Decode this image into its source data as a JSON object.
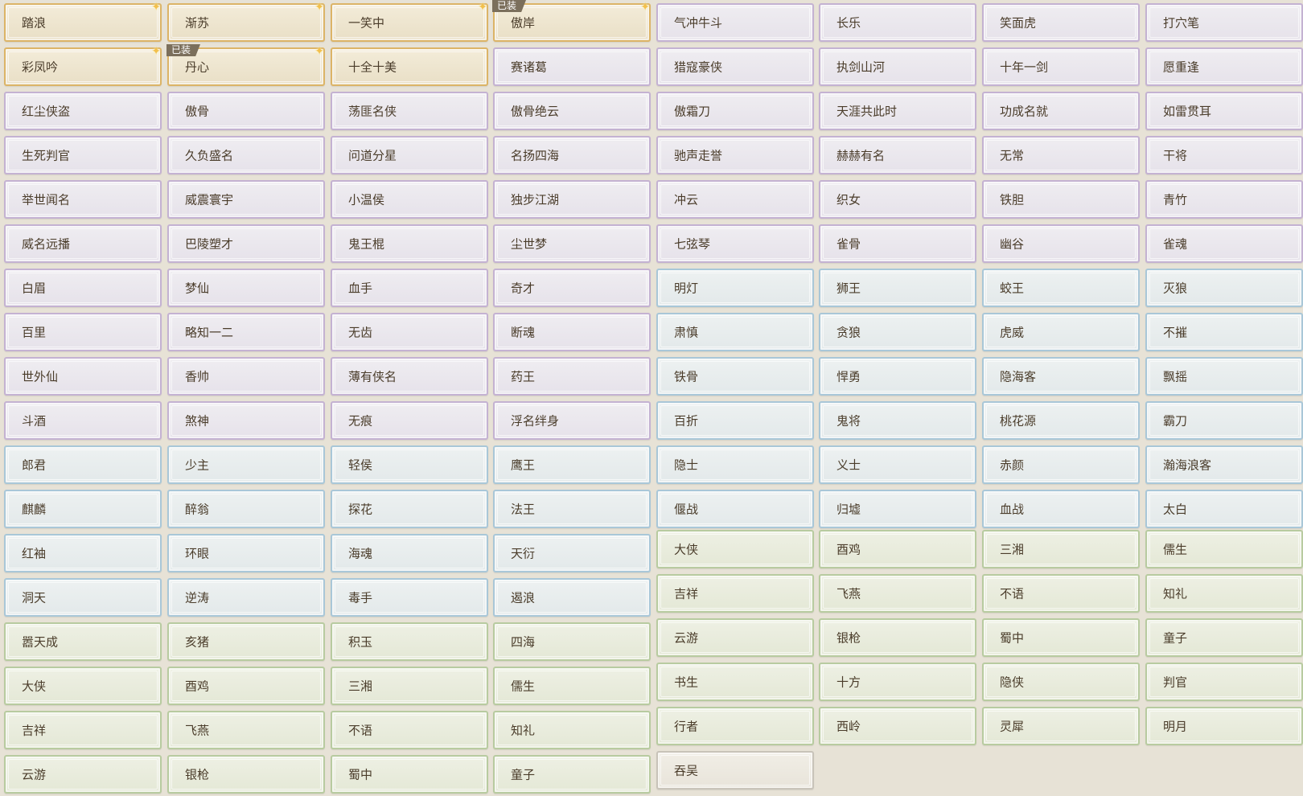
{
  "equipped_badge": "已装",
  "columns": [
    [
      {
        "label": "踏浪",
        "rarity": "gold",
        "sparkle": true
      },
      {
        "label": "彩凤吟",
        "rarity": "gold",
        "sparkle": true
      },
      {
        "label": "红尘侠盗",
        "rarity": "purple"
      },
      {
        "label": "生死判官",
        "rarity": "purple"
      },
      {
        "label": "举世闻名",
        "rarity": "purple"
      },
      {
        "label": "威名远播",
        "rarity": "purple"
      },
      {
        "label": "白眉",
        "rarity": "purple"
      },
      {
        "label": "百里",
        "rarity": "purple"
      },
      {
        "label": "世外仙",
        "rarity": "purple"
      },
      {
        "label": "斗酒",
        "rarity": "purple"
      },
      {
        "label": "郎君",
        "rarity": "blue"
      },
      {
        "label": "麒麟",
        "rarity": "blue"
      },
      {
        "label": "红袖",
        "rarity": "blue"
      },
      {
        "label": "洞天",
        "rarity": "blue"
      },
      {
        "label": "嚣天成",
        "rarity": "green"
      },
      {
        "label": "大侠",
        "rarity": "green"
      },
      {
        "label": "吉祥",
        "rarity": "green"
      },
      {
        "label": "云游",
        "rarity": "green"
      }
    ],
    [
      {
        "label": "渐苏",
        "rarity": "gold",
        "sparkle": true
      },
      {
        "label": "丹心",
        "rarity": "gold",
        "sparkle": true,
        "equipped": true
      },
      {
        "label": "傲骨",
        "rarity": "purple"
      },
      {
        "label": "久负盛名",
        "rarity": "purple"
      },
      {
        "label": "威震寰宇",
        "rarity": "purple"
      },
      {
        "label": "巴陵塑才",
        "rarity": "purple"
      },
      {
        "label": "梦仙",
        "rarity": "purple"
      },
      {
        "label": "略知一二",
        "rarity": "purple"
      },
      {
        "label": "香帅",
        "rarity": "purple"
      },
      {
        "label": "煞神",
        "rarity": "purple"
      },
      {
        "label": "少主",
        "rarity": "blue"
      },
      {
        "label": "醉翁",
        "rarity": "blue"
      },
      {
        "label": "环眼",
        "rarity": "blue"
      },
      {
        "label": "逆涛",
        "rarity": "blue"
      },
      {
        "label": "亥猪",
        "rarity": "green"
      },
      {
        "label": "酉鸡",
        "rarity": "green"
      },
      {
        "label": "飞燕",
        "rarity": "green"
      },
      {
        "label": "银枪",
        "rarity": "green"
      }
    ],
    [
      {
        "label": "一笑中",
        "rarity": "gold",
        "sparkle": true
      },
      {
        "label": "十全十美",
        "rarity": "gold"
      },
      {
        "label": "荡匪名侠",
        "rarity": "purple"
      },
      {
        "label": "问道分星",
        "rarity": "purple"
      },
      {
        "label": "小温侯",
        "rarity": "purple"
      },
      {
        "label": "鬼王棍",
        "rarity": "purple"
      },
      {
        "label": "血手",
        "rarity": "purple"
      },
      {
        "label": "无齿",
        "rarity": "purple"
      },
      {
        "label": "薄有侠名",
        "rarity": "purple"
      },
      {
        "label": "无痕",
        "rarity": "purple"
      },
      {
        "label": "轻侯",
        "rarity": "blue"
      },
      {
        "label": "探花",
        "rarity": "blue"
      },
      {
        "label": "海魂",
        "rarity": "blue"
      },
      {
        "label": "毒手",
        "rarity": "blue"
      },
      {
        "label": "积玉",
        "rarity": "green"
      },
      {
        "label": "三湘",
        "rarity": "green"
      },
      {
        "label": "不语",
        "rarity": "green"
      },
      {
        "label": "蜀中",
        "rarity": "green"
      }
    ],
    [
      {
        "label": "傲岸",
        "rarity": "gold",
        "sparkle": true,
        "equipped": true
      },
      {
        "label": "赛诸葛",
        "rarity": "purple"
      },
      {
        "label": "傲骨绝云",
        "rarity": "purple"
      },
      {
        "label": "名扬四海",
        "rarity": "purple"
      },
      {
        "label": "独步江湖",
        "rarity": "purple"
      },
      {
        "label": "尘世梦",
        "rarity": "purple"
      },
      {
        "label": "奇才",
        "rarity": "purple"
      },
      {
        "label": "断魂",
        "rarity": "purple"
      },
      {
        "label": "药王",
        "rarity": "purple"
      },
      {
        "label": "浮名绊身",
        "rarity": "purple"
      },
      {
        "label": "鹰王",
        "rarity": "blue"
      },
      {
        "label": "法王",
        "rarity": "blue"
      },
      {
        "label": "天衍",
        "rarity": "blue"
      },
      {
        "label": "遏浪",
        "rarity": "blue"
      },
      {
        "label": "四海",
        "rarity": "green"
      },
      {
        "label": "儒生",
        "rarity": "green"
      },
      {
        "label": "知礼",
        "rarity": "green"
      },
      {
        "label": "童子",
        "rarity": "green"
      }
    ],
    [
      {
        "label": "气冲牛斗",
        "rarity": "purple"
      },
      {
        "label": "猎寇豪侠",
        "rarity": "purple"
      },
      {
        "label": "傲霜刀",
        "rarity": "purple"
      },
      {
        "label": "驰声走誉",
        "rarity": "purple"
      },
      {
        "label": "冲云",
        "rarity": "purple"
      },
      {
        "label": "七弦琴",
        "rarity": "purple"
      },
      {
        "label": "明灯",
        "rarity": "blue"
      },
      {
        "label": "肃慎",
        "rarity": "blue"
      },
      {
        "label": "铁骨",
        "rarity": "blue"
      },
      {
        "label": "百折",
        "rarity": "blue"
      },
      {
        "label": "隐士",
        "rarity": "blue"
      },
      {
        "label": "偃战",
        "rarity": "blue"
      },
      {
        "label": "大侠",
        "rarity": "green"
      },
      {
        "label": "吉祥",
        "rarity": "green"
      },
      {
        "label": "云游",
        "rarity": "green"
      },
      {
        "label": "书生",
        "rarity": "green"
      },
      {
        "label": "行者",
        "rarity": "green"
      },
      {
        "label": "吞吴",
        "rarity": "grey"
      }
    ],
    [
      {
        "label": "长乐",
        "rarity": "purple"
      },
      {
        "label": "执剑山河",
        "rarity": "purple"
      },
      {
        "label": "天涯共此时",
        "rarity": "purple"
      },
      {
        "label": "赫赫有名",
        "rarity": "purple"
      },
      {
        "label": "织女",
        "rarity": "purple"
      },
      {
        "label": "雀骨",
        "rarity": "purple"
      },
      {
        "label": "狮王",
        "rarity": "blue"
      },
      {
        "label": "贪狼",
        "rarity": "blue"
      },
      {
        "label": "悍勇",
        "rarity": "blue"
      },
      {
        "label": "鬼将",
        "rarity": "blue"
      },
      {
        "label": "义士",
        "rarity": "blue"
      },
      {
        "label": "归墟",
        "rarity": "blue"
      },
      {
        "label": "酉鸡",
        "rarity": "green"
      },
      {
        "label": "飞燕",
        "rarity": "green"
      },
      {
        "label": "银枪",
        "rarity": "green"
      },
      {
        "label": "十方",
        "rarity": "green"
      },
      {
        "label": "西岭",
        "rarity": "green"
      }
    ],
    [
      {
        "label": "笑面虎",
        "rarity": "purple"
      },
      {
        "label": "十年一剑",
        "rarity": "purple"
      },
      {
        "label": "功成名就",
        "rarity": "purple"
      },
      {
        "label": "无常",
        "rarity": "purple"
      },
      {
        "label": "铁胆",
        "rarity": "purple"
      },
      {
        "label": "幽谷",
        "rarity": "purple"
      },
      {
        "label": "蛟王",
        "rarity": "blue"
      },
      {
        "label": "虎威",
        "rarity": "blue"
      },
      {
        "label": "隐海客",
        "rarity": "blue"
      },
      {
        "label": "桃花源",
        "rarity": "blue"
      },
      {
        "label": "赤颜",
        "rarity": "blue"
      },
      {
        "label": "血战",
        "rarity": "blue"
      },
      {
        "label": "三湘",
        "rarity": "green"
      },
      {
        "label": "不语",
        "rarity": "green"
      },
      {
        "label": "蜀中",
        "rarity": "green"
      },
      {
        "label": "隐侠",
        "rarity": "green"
      },
      {
        "label": "灵犀",
        "rarity": "green"
      }
    ],
    [
      {
        "label": "打穴笔",
        "rarity": "purple"
      },
      {
        "label": "愿重逢",
        "rarity": "purple"
      },
      {
        "label": "如雷贯耳",
        "rarity": "purple"
      },
      {
        "label": "干将",
        "rarity": "purple"
      },
      {
        "label": "青竹",
        "rarity": "purple"
      },
      {
        "label": "雀魂",
        "rarity": "purple"
      },
      {
        "label": "灭狼",
        "rarity": "blue"
      },
      {
        "label": "不摧",
        "rarity": "blue"
      },
      {
        "label": "飘摇",
        "rarity": "blue"
      },
      {
        "label": "霸刀",
        "rarity": "blue"
      },
      {
        "label": "瀚海浪客",
        "rarity": "blue"
      },
      {
        "label": "太白",
        "rarity": "blue"
      },
      {
        "label": "儒生",
        "rarity": "green"
      },
      {
        "label": "知礼",
        "rarity": "green"
      },
      {
        "label": "童子",
        "rarity": "green"
      },
      {
        "label": "判官",
        "rarity": "green"
      },
      {
        "label": "明月",
        "rarity": "green"
      }
    ]
  ]
}
